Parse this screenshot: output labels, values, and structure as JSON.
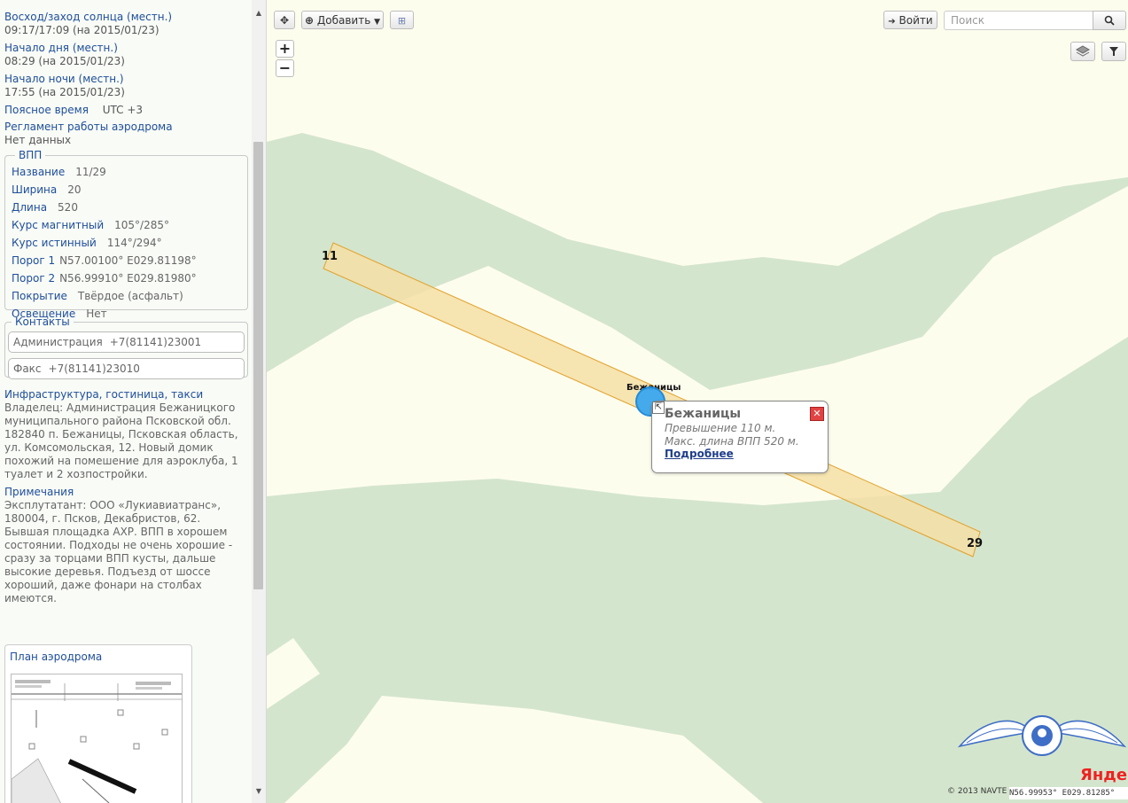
{
  "sidebar": {
    "sunrise": {
      "label": "Восход/заход солнца (местн.)",
      "value": "09:17/17:09 (на 2015/01/23)"
    },
    "day_start": {
      "label": "Начало дня (местн.)",
      "value": "08:29 (на 2015/01/23)"
    },
    "night_start": {
      "label": "Начало ночи (местн.)",
      "value": "17:55 (на 2015/01/23)"
    },
    "timezone": {
      "label": "Поясное время",
      "value": "UTC +3"
    },
    "schedule": {
      "label": "Регламент работы аэродрома",
      "value": "Нет данных"
    },
    "runway": {
      "legend": "ВПП",
      "rows": [
        {
          "label": "Название",
          "value": "11/29"
        },
        {
          "label": "Ширина",
          "value": "20"
        },
        {
          "label": "Длина",
          "value": "520"
        },
        {
          "label": "Курс магнитный",
          "value": "105°/285°"
        },
        {
          "label": "Курс истинный",
          "value": "114°/294°"
        },
        {
          "label": "Порог 1",
          "value": "N57.00100° E029.81198°"
        },
        {
          "label": "Порог 2",
          "value": "N56.99910° E029.81980°"
        },
        {
          "label": "Покрытие",
          "value": "Твёрдое (асфальт)"
        },
        {
          "label": "Освещение",
          "value": "Нет"
        }
      ]
    },
    "contacts": {
      "legend": "Контакты",
      "items": [
        {
          "label": "Администрация",
          "value": "+7(81141)23001"
        },
        {
          "label": "Факс",
          "value": "+7(81141)23010"
        }
      ]
    },
    "infrastructure": {
      "label": "Инфраструктура, гостиница, такси",
      "text": "Владелец: Администрация Бежаницкого муниципального района Псковской обл. 182840 п. Бежаницы, Псковская область, ул. Комсомольская, 12. Новый домик похожий на помешение для аэроклуба, 1 туалет и 2 хозпостройки."
    },
    "notes": {
      "label": "Примечания",
      "text": "Эксплутатант: ООО «Лукиавиатранс», 180004, г. Псков, Декабристов, 62. Бывшая площадка АХР. ВПП в хорошем состоянии. Подходы не очень хорошие - сразу за торцами ВПП кусты, дальше высокие деревья. Подъезд от шоссе хороший, даже фонари на столбах имеются."
    },
    "plan": {
      "label": "План аэродрома"
    }
  },
  "toolbar": {
    "move_icon": "move-cross-icon",
    "add_label": "Добавить",
    "ruler_icon": "ruler-icon",
    "login_label": "Войти",
    "search_placeholder": "Поиск",
    "search_icon": "search-icon",
    "layers_icon": "layers-icon",
    "filter_icon": "filter-icon"
  },
  "map": {
    "runway_end_a": "11",
    "runway_end_b": "29",
    "marker_label": "Бежаницы",
    "popup": {
      "title": "Бежаницы",
      "elevation": "Превышение 110 м.",
      "max_length": "Макс. длина ВПП 520 м.",
      "more_link": "Подробнее"
    },
    "yandex_logo": "Яндекс",
    "copyright": "© 2013 NAVTE",
    "coords": "N56.99953° E029.81285°",
    "colors": {
      "forest": "#d4e5cd",
      "field": "#fdfdee",
      "runway_fill": "#f5dfa6",
      "runway_stroke": "#e2a12a"
    }
  }
}
